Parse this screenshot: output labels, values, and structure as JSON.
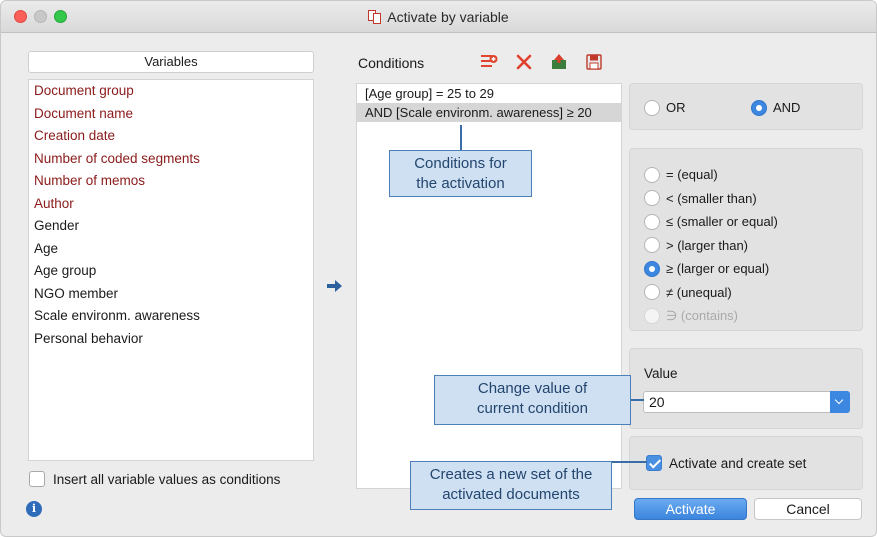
{
  "window": {
    "title": "Activate by variable"
  },
  "variables": {
    "header": "Variables",
    "items": [
      {
        "label": "Document group",
        "kind": "system"
      },
      {
        "label": "Document name",
        "kind": "system"
      },
      {
        "label": "Creation date",
        "kind": "system"
      },
      {
        "label": "Number of coded segments",
        "kind": "system"
      },
      {
        "label": "Number of memos",
        "kind": "system"
      },
      {
        "label": "Author",
        "kind": "system"
      },
      {
        "label": "Gender",
        "kind": "user"
      },
      {
        "label": "Age",
        "kind": "user"
      },
      {
        "label": "Age group",
        "kind": "user"
      },
      {
        "label": "NGO member",
        "kind": "user"
      },
      {
        "label": "Scale environm. awareness",
        "kind": "user"
      },
      {
        "label": "Personal behavior",
        "kind": "user"
      }
    ],
    "insert_all_label": "Insert all variable values as conditions",
    "insert_all_checked": false
  },
  "conditions": {
    "label": "Conditions",
    "toolbar_icons": [
      "new-condition-icon",
      "delete-icon",
      "open-icon",
      "save-icon"
    ],
    "rows": [
      {
        "text": "[Age group] = 25 to 29",
        "selected": false
      },
      {
        "text": "AND [Scale environm. awareness] ≥ 20",
        "selected": true
      }
    ]
  },
  "logic": {
    "or_label": "OR",
    "and_label": "AND",
    "selected": "AND"
  },
  "operators": {
    "items": [
      {
        "label": "= (equal)",
        "selected": false,
        "disabled": false
      },
      {
        "label": "< (smaller than)",
        "selected": false,
        "disabled": false
      },
      {
        "label": "≤ (smaller or equal)",
        "selected": false,
        "disabled": false
      },
      {
        "label": "> (larger than)",
        "selected": false,
        "disabled": false
      },
      {
        "label": "≥ (larger or equal)",
        "selected": true,
        "disabled": false
      },
      {
        "label": "≠ (unequal)",
        "selected": false,
        "disabled": false
      },
      {
        "label": "∋ (contains)",
        "selected": false,
        "disabled": true
      }
    ]
  },
  "value": {
    "label": "Value",
    "current": "20"
  },
  "create_set": {
    "label": "Activate and create set",
    "checked": true
  },
  "buttons": {
    "activate": "Activate",
    "cancel": "Cancel"
  },
  "callouts": {
    "conditions": [
      "Conditions for",
      "the activation"
    ],
    "value": [
      "Change value of",
      "current condition"
    ],
    "set": [
      "Creates a new set of the",
      "activated documents"
    ]
  },
  "colors": {
    "system_variable": "#8b1a1a",
    "accent": "#3c87e0",
    "callout_fill": "#cfe0f3",
    "callout_border": "#4d7fb8"
  }
}
